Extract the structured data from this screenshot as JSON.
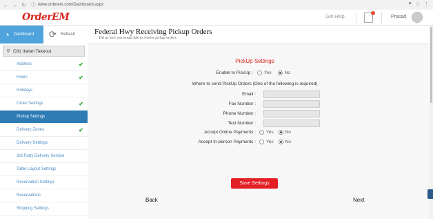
{
  "browser": {
    "url": "www.orderem.com/Dashboard.aspx"
  },
  "header": {
    "logo": "OrderEM",
    "get_help": "Get Help",
    "user_name": "Prasad"
  },
  "sidebar": {
    "dashboard_label": "Dashboard",
    "refresh_label": "Refresh",
    "search_value": "C81 Italian Takeout",
    "items": [
      {
        "label": "Address",
        "done": true
      },
      {
        "label": "Hours",
        "done": true
      },
      {
        "label": "Holidays",
        "done": false
      },
      {
        "label": "Order Settings",
        "done": true
      },
      {
        "label": "Pickup Settings",
        "done": false,
        "active": true
      },
      {
        "label": "Delivery Zones",
        "done": true
      },
      {
        "label": "Delivery Settings",
        "done": false
      },
      {
        "label": "3rd Party Delivery Service",
        "done": false
      },
      {
        "label": "Table Layout Settings",
        "done": false
      },
      {
        "label": "Reservation Settings",
        "done": false
      },
      {
        "label": "Reservations",
        "done": false
      },
      {
        "label": "Shipping Settings",
        "done": false
      }
    ]
  },
  "page": {
    "title": "Federal Hwy Receiving Pickup Orders",
    "subtitle": "Tell us how you would like to receive pickup orders.",
    "section_title": "PickUp Settings",
    "enable_label": "Enable to PickUp :",
    "enable_value": "No",
    "where_label": "Where to send PickUp Orders (One of the following is required)",
    "email_label": "Email :",
    "fax_label": "Fax Number :",
    "phone_label": "Phone Number :",
    "text_label": "Text Number :",
    "online_label": "Accept Online Payments :",
    "online_value": "No",
    "inperson_label": "Accept In-person Payments :",
    "inperson_value": "No",
    "yes": "Yes",
    "no": "No",
    "save_button": "Save Settings",
    "back": "Back",
    "next": "Next"
  }
}
